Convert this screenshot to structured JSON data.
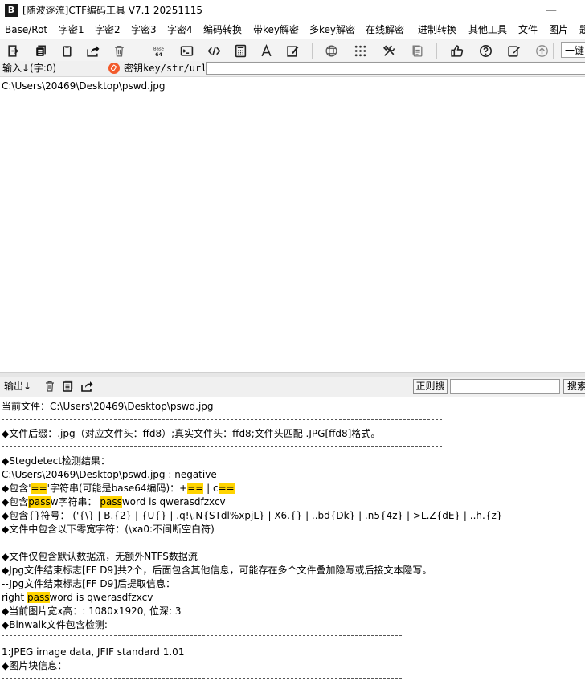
{
  "window": {
    "app_icon": "B",
    "title": "[随波逐流]CTF编码工具 V7.1  20251115",
    "minimize_glyph": "—"
  },
  "menu": [
    "Base/Rot",
    "字密1",
    "字密2",
    "字密3",
    "字密4",
    "编码转换",
    "带key解密",
    "多key解密",
    "在线解密",
    "进制转换",
    "其他工具",
    "文件",
    "图片",
    "题"
  ],
  "toolbar": {
    "icons": [
      "import-file-icon",
      "copy-icon",
      "paste-icon",
      "share-icon",
      "trash-icon",
      "base64-icon",
      "terminal-icon",
      "code-icon",
      "calculator-icon",
      "font-icon",
      "edit-form-icon",
      "globe-icon",
      "grid-icon",
      "tools-icon",
      "file-copy-icon",
      "thumbs-up-icon",
      "help-icon",
      "edit-icon",
      "arrow-up-icon"
    ],
    "base64_text": [
      "Base",
      "64"
    ],
    "combo_value": "一键"
  },
  "input_bar": {
    "label": "输入↓(字:0)",
    "key_label": "密钥key/str/url:",
    "key_value": ""
  },
  "input": {
    "text": "C:\\Users\\20469\\Desktop\\pswd.jpg"
  },
  "output_bar": {
    "label": "输出↓",
    "regex_button": "正则搜",
    "regex_value": "",
    "search_button": "搜索"
  },
  "output": {
    "separator": "------------------------------------------------------------------------------------------------",
    "lines": [
      [
        {
          "t": "当前文件：C:\\Users\\20469\\Desktop\\pswd.jpg"
        }
      ],
      [],
      [
        {
          "t": "◆文件后缀：.jpg（对应文件头：ffd8）;真实文件头：ffd8;文件头匹配 .JPG[ffd8]格式。"
        }
      ],
      [],
      [
        {
          "t": "◆Stegdetect检测结果："
        }
      ],
      [
        {
          "t": "C:\\Users\\20469\\Desktop\\pswd.jpg : negative"
        }
      ],
      [
        {
          "t": "◆包含'"
        },
        {
          "t": "==",
          "hl": true
        },
        {
          "t": "'字符串(可能是base64编码)：+"
        },
        {
          "t": "==",
          "hl": true
        },
        {
          "t": " | c"
        },
        {
          "t": "==",
          "hl": true
        }
      ],
      [
        {
          "t": "◆包含"
        },
        {
          "t": "pass",
          "hl": true
        },
        {
          "t": "w字符串：  "
        },
        {
          "t": "pass",
          "hl": true
        },
        {
          "t": "word is qwerasdfzxcv"
        }
      ],
      [
        {
          "t": "◆包含{}符号：  ('{\\} | B.{2} | {U{} | .q!\\.N{STdl%xpjL} | X6.{} | ..bd{Dk} | .n5{4z} | >L.Z{dE} | ..h.{z}"
        }
      ],
      [
        {
          "t": "◆文件中包含以下零宽字符：(\\xa0:不间断空白符)"
        }
      ],
      [],
      [
        {
          "t": "◆文件仅包含默认数据流，无额外NTFS数据流"
        }
      ],
      [
        {
          "t": "◆Jpg文件结束标志[FF D9]共2个，后面包含其他信息，可能存在多个文件叠加隐写或后接文本隐写。"
        }
      ],
      [
        {
          "t": "--Jpg文件结束标志[FF D9]后提取信息："
        }
      ],
      [
        {
          "t": "right "
        },
        {
          "t": "pass",
          "hl": true
        },
        {
          "t": "word is qwerasdfzxcv"
        }
      ],
      [
        {
          "t": "◆当前图片宽x高：: 1080x1920, 位深: 3"
        }
      ],
      [
        {
          "t": "◆Binwalk文件包含检测:"
        }
      ],
      [],
      [
        {
          "t": "1:JPEG image data, JFIF standard 1.01"
        }
      ],
      [
        {
          "t": "◆图片块信息："
        }
      ]
    ]
  }
}
